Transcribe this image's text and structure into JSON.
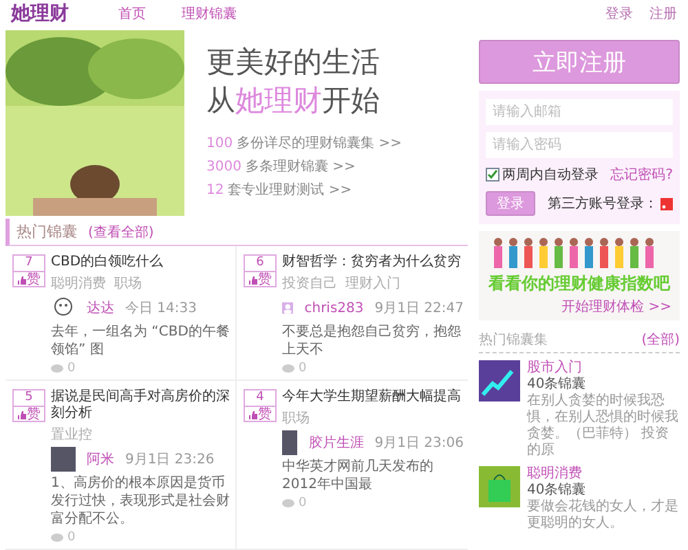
{
  "header": {
    "logo": "她理财",
    "nav": [
      {
        "label": "首页",
        "selected": false
      },
      {
        "label": "理财锦囊",
        "selected": false
      }
    ],
    "links": [
      "登录",
      "注册"
    ]
  },
  "hero": {
    "headline_1": "更美好的生活",
    "headline_2_pre": "从",
    "headline_2_brand": "她理财",
    "headline_2_post": "开始",
    "stats": [
      {
        "number": "100",
        "label": "多份详尽的理财锦囊集 >>"
      },
      {
        "number": "3000",
        "label": "多条理财锦囊 >>"
      },
      {
        "number": "12",
        "label": "套专业理财测试 >>"
      }
    ]
  },
  "hot": {
    "title": "热门锦囊",
    "more": "(查看全部)",
    "cards": [
      {
        "votes": "7",
        "vote_label": "赞",
        "title": "CBD的白领吃什么",
        "tags": [
          "聪明消费",
          "职场"
        ],
        "author": "达达",
        "time": "今日 14:33",
        "excerpt": "去年，一组名为 “CBD的午餐领馅” 图",
        "comments": "0"
      },
      {
        "votes": "6",
        "vote_label": "赞",
        "title": "财智哲学：贫穷者为什么贫穷",
        "tags": [
          "投资自己",
          "理财入门"
        ],
        "author": "chris283",
        "time": "9月1日 22:47",
        "excerpt": "不要总是抱怨自己贫穷，抱怨上天不",
        "comments": "0"
      },
      {
        "votes": "5",
        "vote_label": "赞",
        "title": "据说是民间高手对高房价的深刻分析",
        "tags": [
          "置业控"
        ],
        "author": "阿米",
        "time": "9月1日 23:26",
        "excerpt": "1、高房价的根本原因是货币发行过快，表现形式是社会财富分配不公。",
        "comments": "0"
      },
      {
        "votes": "4",
        "vote_label": "赞",
        "title": "今年大学生期望薪酬大幅提高",
        "tags": [
          "职场"
        ],
        "author": "胶片生涯",
        "time": "9月1日 23:06",
        "excerpt": "中华英才网前几天发布的2012年中国最",
        "comments": "0"
      }
    ]
  },
  "sidebar": {
    "register_button": "立即注册",
    "login": {
      "email_placeholder": "请输入邮箱",
      "password_placeholder": "请输入密码",
      "remember_label": "两周内自动登录",
      "remember_checked": true,
      "forgot": "忘记密码?",
      "login_button": "登录",
      "third_party": "第三方账号登录："
    },
    "banner": {
      "caption": "看看你的理财健康指数吧",
      "link": "开始理财体检 >>"
    },
    "collections": {
      "title": "热门锦囊集",
      "more": "(全部)",
      "items": [
        {
          "title": "股市入门",
          "count": "40条锦囊",
          "excerpt": "在别人贪婪的时候我恐惧，在别人恐惧的时候我贪婪。（巴菲特） 投资的原"
        },
        {
          "title": "聪明消费",
          "count": "40条锦囊",
          "excerpt": "要做会花钱的女人，才是更聪明的女人。"
        }
      ]
    }
  }
}
